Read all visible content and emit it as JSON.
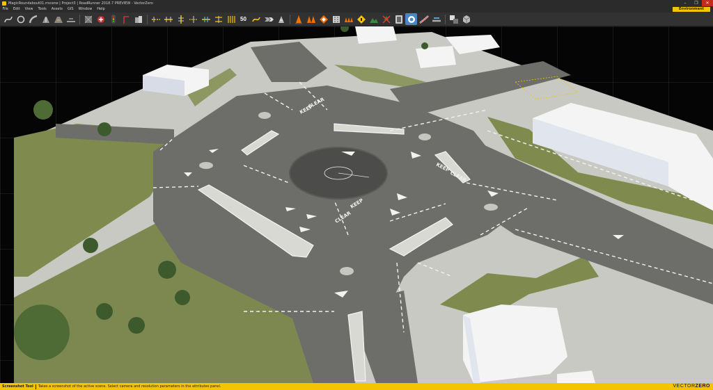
{
  "window": {
    "title": "MagicRoundabout01.rrscene | Project3 | RoadRunner 2018.7 PREVIEW - VectorZero",
    "controls": [
      "–",
      "❐",
      "✕"
    ]
  },
  "menu": {
    "items": [
      "File",
      "Edit",
      "View",
      "Tools",
      "Assets",
      "GIS",
      "Window",
      "Help"
    ],
    "environment_label": "Environment"
  },
  "toolbar": {
    "speed_label": "50",
    "active_tool": "screenshot-tool",
    "tools": [
      "road-plan-tool",
      "roundabout-tool",
      "road-construction-tool",
      "lane-tool",
      "lane-width-tool",
      "lane-add-tool",
      "sep-1",
      "surface-tool",
      "junction-tool",
      "signal-tool",
      "prop-tool",
      "prop-curve-tool",
      "sep-2",
      "lane-marking-tool",
      "marking-point-tool",
      "marking-curve-tool",
      "marking-polygon-tool",
      "lane-carving-tool",
      "stop-line-tool",
      "crosswalk-tool",
      "speed-tool",
      "route-tool",
      "sign-tool",
      "sep-3",
      "cone-tool",
      "prop-point-tool",
      "prop-polygon-tool",
      "building-tool",
      "barrier-tool",
      "warning-sign-tool",
      "terrain-tool",
      "clear-tool",
      "parking-tool",
      "screenshot-tool",
      "export-tool",
      "lane-link-tool",
      "sep-4",
      "layer-tool",
      "cube-tool"
    ]
  },
  "status": {
    "tool_name": "Screenshot Tool",
    "message": "Takes a screenshot of the active scene.  Select camera and resolution parameters in the attributes panel.",
    "brand_light": "VECTOR",
    "brand_bold": "ZERO"
  },
  "scene": {
    "road_markings": [
      "KEEP",
      "CLEAR",
      "KEEP",
      "CLEAR",
      "KEEP",
      "CLEAR"
    ],
    "colors": {
      "background": "#050505",
      "ground": "#c7c9c2",
      "grass": "#7f8a4e",
      "asphalt": "#6d6d69",
      "roundabout_center": "#4c4c4a",
      "marking": "#f2f2f2",
      "building": "#f4f4f4",
      "accent": "#f5c400"
    }
  }
}
